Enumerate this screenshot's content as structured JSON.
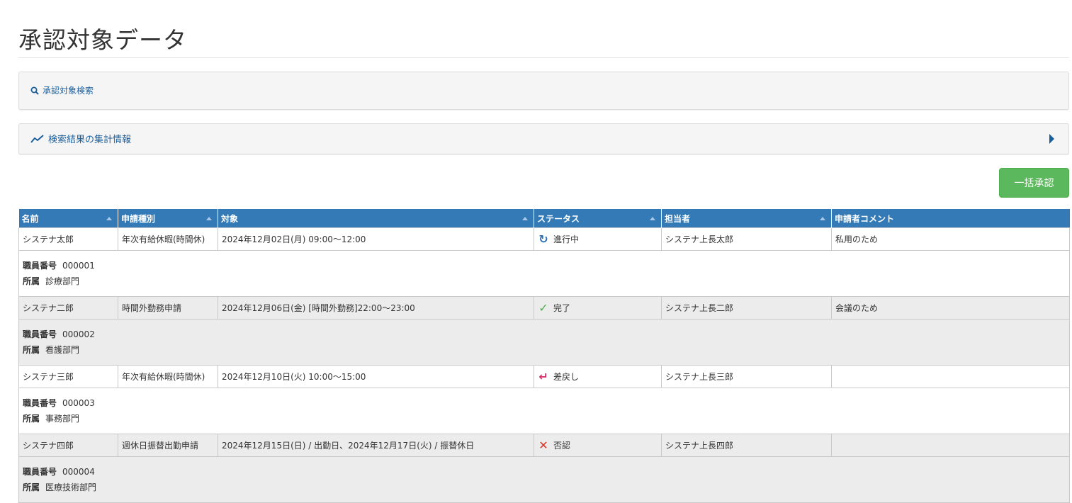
{
  "page": {
    "title": "承認対象データ"
  },
  "search_panel": {
    "label": "承認対象検索",
    "icon": "search-icon"
  },
  "summary_panel": {
    "label": "検索結果の集計情報",
    "icon": "trend-line-icon"
  },
  "bulk_approve": {
    "label": "一括承認"
  },
  "table": {
    "columns": [
      "名前",
      "申請種別",
      "対象",
      "ステータス",
      "担当者",
      "申請者コメント"
    ],
    "labels": {
      "employee_no": "職員番号",
      "department": "所属"
    },
    "rows": [
      {
        "name": "システナ太郎",
        "type": "年次有給休暇(時間休)",
        "target": "2024年12月02日(月) 09:00～12:00",
        "status": "進行中",
        "status_icon": "refresh-icon",
        "assignee": "システナ上長太郎",
        "comment": "私用のため",
        "employee_no": "000001",
        "department": "診療部門"
      },
      {
        "name": "システナ二郎",
        "type": "時間外勤務申請",
        "target": "2024年12月06日(金) [時間外勤務]22:00～23:00",
        "status": "完了",
        "status_icon": "check-icon",
        "assignee": "システナ上長二郎",
        "comment": "会議のため",
        "employee_no": "000002",
        "department": "看護部門"
      },
      {
        "name": "システナ三郎",
        "type": "年次有給休暇(時間休)",
        "target": "2024年12月10日(火) 10:00～15:00",
        "status": "差戻し",
        "status_icon": "return-arrow-icon",
        "assignee": "システナ上長三郎",
        "comment": "",
        "employee_no": "000003",
        "department": "事務部門"
      },
      {
        "name": "システナ四郎",
        "type": "週休日振替出勤申請",
        "target": "2024年12月15日(日) / 出勤日、2024年12月17日(火) / 振替休日",
        "status": "否認",
        "status_icon": "cross-icon",
        "assignee": "システナ上長四郎",
        "comment": "",
        "employee_no": "000004",
        "department": "医療技術部門"
      }
    ]
  },
  "colors": {
    "header_bg": "#337ab7",
    "link": "#1a5f9c",
    "approve_button": "#5cb85c",
    "status_progress": "#2a6fb5",
    "status_done": "#4cae4c",
    "status_return": "#d6336c",
    "status_deny": "#d9332a"
  }
}
